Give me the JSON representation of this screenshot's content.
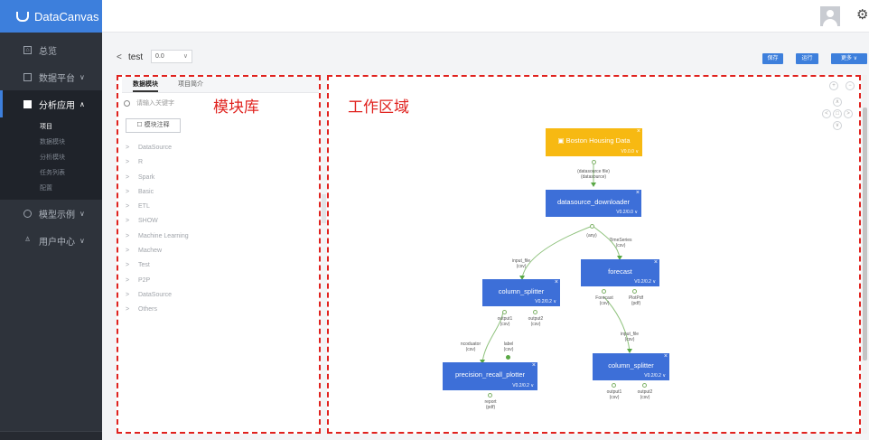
{
  "brand": {
    "name": "DataCanvas"
  },
  "sidebar": {
    "items": [
      {
        "label": "总览",
        "icon": "home-icon",
        "chevron": ""
      },
      {
        "label": "数据平台",
        "icon": "database-icon",
        "chevron": "∨"
      },
      {
        "label": "分析应用",
        "icon": "monitor-icon",
        "chevron": "∧"
      },
      {
        "label": "模型示例",
        "icon": "bulb-icon",
        "chevron": "∨"
      },
      {
        "label": "用户中心",
        "icon": "user-icon",
        "chevron": "∨"
      }
    ],
    "subitems": [
      "项目",
      "数据模块",
      "分析模块",
      "任务列表",
      "配置"
    ]
  },
  "project": {
    "back": "<",
    "name": "test",
    "version": "0.0",
    "save_label": "保存",
    "run_label": "运行",
    "more_label": "更多 ∨"
  },
  "module_panel": {
    "tabs": [
      "数据模块",
      "项目简介"
    ],
    "search_placeholder": "请输入关键字",
    "annot_button": "模块注释",
    "overlay_label": "模块库",
    "modules": [
      "DataSource",
      "R",
      "Spark",
      "Basic",
      "ETL",
      "SHOW",
      "Machine Learning",
      "Machew",
      "Test",
      "P2P",
      "DataSource",
      "Others"
    ]
  },
  "work_area": {
    "overlay_label": "工作区域",
    "nodes": {
      "boston": {
        "label": "Boston Housing Data",
        "version": "V0.0.0"
      },
      "downloader": {
        "label": "datasource_downloader",
        "version": "V0.2/0.0"
      },
      "forecast": {
        "label": "forecast",
        "version": "V0.2/0.2"
      },
      "splitter1": {
        "label": "column_splitter",
        "version": "V0.2/0.2"
      },
      "plotter": {
        "label": "precision_recall_plotter",
        "version": "V0.2/0.2"
      },
      "splitter2": {
        "label": "column_splitter",
        "version": "V0.2/0.2"
      }
    },
    "ports": {
      "boston_out": "(datasource file)\n(datasource)",
      "dl_out": "(any)",
      "split1_in": "input_file\n(csv)",
      "fc_in": "TimeSeries\n(csv)",
      "fc_out1": "Forecast\n(csv)",
      "fc_out2": "PlotPdf\n(pdf)",
      "split1_out1": "output1\n(csv)",
      "split1_out2": "output2\n(csv)",
      "plot_in1": "ncoduator\n(csv)",
      "plot_in2": "label\n(csv)",
      "plot_out": "report\n(pdf)",
      "split2_in": "input_file\n(csv)",
      "split2_out1": "output1\n(csv)",
      "split2_out2": "output2\n(csv)"
    }
  },
  "colors": {
    "accent": "#3d7fdc",
    "node_blue": "#3d6fd8",
    "node_gold": "#f7b912",
    "edge_green": "#6db05a",
    "annotation_red": "#e0221e"
  }
}
